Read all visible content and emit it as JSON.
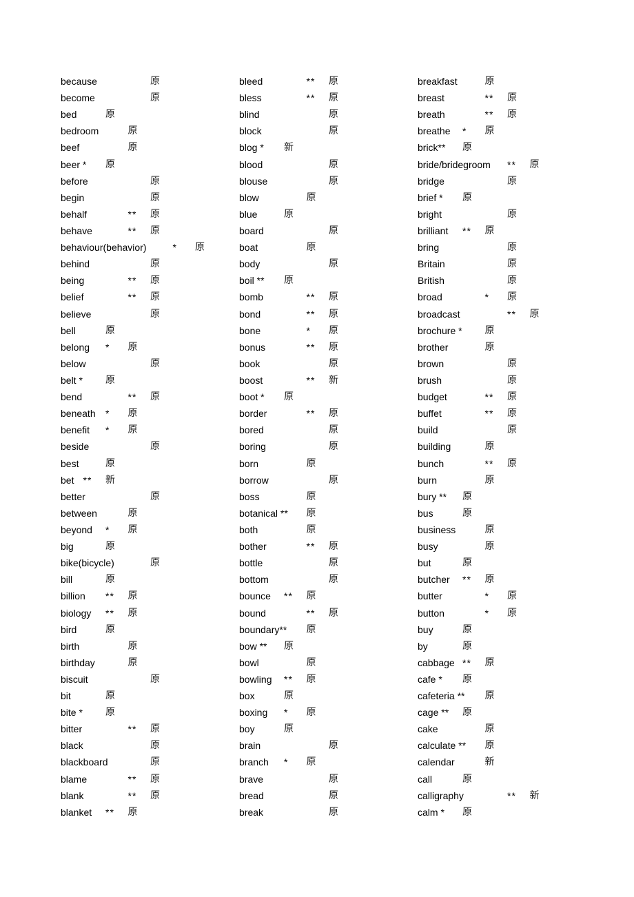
{
  "document": {
    "type": "vocabulary word list",
    "columns": [
      {
        "entries": [
          "because\t\t\t原",
          "become\t\t\t原",
          "bed\t\t原",
          "bedroom\t\t原",
          "beef\t\t原",
          "beer *\t原",
          "before\t\t\t原",
          "begin\t\t\t原",
          "behalf\t\t**\t原",
          "behave\t\t**\t原",
          "behaviour(behavior)\t*\t原",
          "behind\t\t\t原",
          "being\t\t**\t原",
          "belief\t\t**\t原",
          "believe\t\t\t原",
          "bell\t\t原",
          "belong\t*\t原",
          "below\t\t\t原",
          "belt *\t原",
          "bend\t\t**\t原",
          "beneath\t*\t原",
          "benefit\t*\t原",
          "beside\t\t\t原",
          "best\t\t原",
          "bet\t**\t新",
          "better\t\t\t原",
          "between\t\t原",
          "beyond\t*\t原",
          "big\t\t原",
          "bike(bicycle)\t\t原",
          "bill\t\t原",
          "billion\t**\t原",
          "biology\t**\t原",
          "bird\t\t原",
          "birth\t\t原",
          "birthday\t\t原",
          "biscuit\t\t\t原",
          "bit\t\t原",
          "bite *\t原",
          "bitter\t\t**\t原",
          "black\t\t\t原",
          "blackboard\t\t原",
          "blame\t\t**\t原",
          "blank\t\t**\t原",
          "blanket\t**\t原"
        ]
      },
      {
        "entries": [
          "bleed\t\t**\t原",
          "bless\t\t**\t原",
          "blind\t\t\t原",
          "block\t\t\t原",
          "blog *\t新",
          "blood\t\t\t原",
          "blouse\t\t\t原",
          "blow\t\t原",
          "blue\t\t原",
          "board\t\t\t原",
          "boat\t\t原",
          "body\t\t\t原",
          "boil **\t原",
          "bomb\t\t**\t原",
          "bond\t\t**\t原",
          "bone\t\t*\t原",
          "bonus\t\t**\t原",
          "book\t\t\t原",
          "boost\t\t**\t新",
          "boot *\t原",
          "border\t\t**\t原",
          "bored\t\t\t原",
          "boring\t\t\t原",
          "born\t\t原",
          "borrow\t\t\t原",
          "boss\t\t原",
          "botanical **\t原",
          "both\t\t原",
          "bother\t\t**\t原",
          "bottle\t\t\t原",
          "bottom\t\t\t原",
          "bounce\t**\t原",
          "bound\t\t**\t原",
          "boundary**\t原",
          "bow **\t原",
          "bowl\t\t原",
          "bowling\t**\t原",
          "box\t\t原",
          "boxing\t*\t原",
          "boy\t\t原",
          "brain\t\t\t原",
          "branch\t*\t原",
          "brave\t\t\t原",
          "bread\t\t\t原",
          "break\t\t\t原"
        ]
      },
      {
        "entries": [
          "breakfast\t\t原",
          "breast\t\t**\t原",
          "breath\t\t**\t原",
          "breathe\t*\t原",
          "brick**\t原",
          "bride/bridegroom\t**\t原",
          "bridge\t\t\t原",
          "brief *\t原",
          "bright\t\t\t原",
          "brilliant\t**\t原",
          "bring\t\t\t原",
          "Britain\t\t\t原",
          "British\t\t\t原",
          "broad\t\t*\t原",
          "broadcast\t\t**\t原",
          "brochure *\t原",
          "brother\t\t原",
          "brown\t\t\t原",
          "brush\t\t\t原",
          "budget\t\t**\t原",
          "buffet\t\t**\t原",
          "build\t\t\t原",
          "building\t\t原",
          "bunch\t\t**\t原",
          "burn\t\t原",
          "bury **\t原",
          "bus\t\t原",
          "business\t\t原",
          "busy\t\t原",
          "but\t\t原",
          "butcher\t**\t原",
          "butter\t\t*\t原",
          "button\t\t*\t原",
          "buy\t\t原",
          "by\t\t原",
          "cabbage\t**\t原",
          "cafe *\t原",
          "cafeteria **\t原",
          "cage **\t原",
          "cake\t\t原",
          "calculate **\t原",
          "calendar\t\t新",
          "call\t\t原",
          "calligraphy\t\t**\t新",
          "calm *\t原"
        ]
      }
    ]
  }
}
